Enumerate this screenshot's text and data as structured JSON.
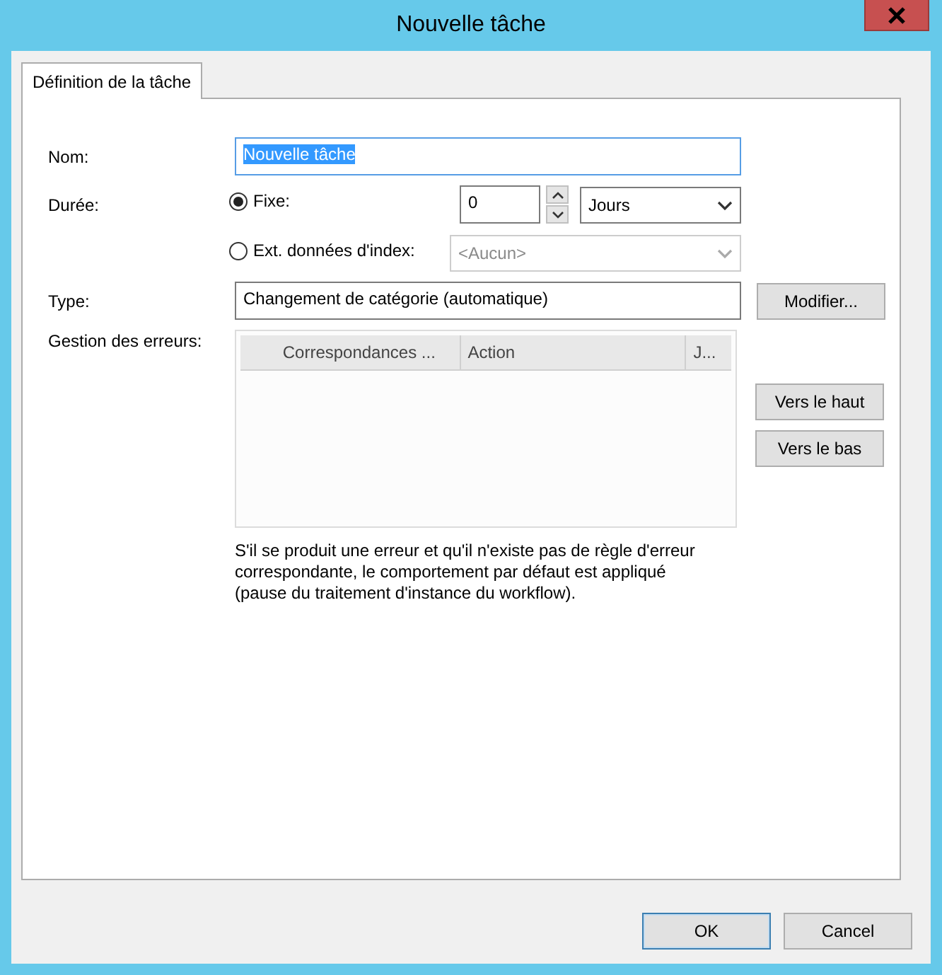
{
  "window": {
    "title": "Nouvelle tâche"
  },
  "tabs": [
    {
      "label": "Définition de la tâche",
      "selected": true
    }
  ],
  "name": {
    "label": "Nom:",
    "value": "Nouvelle tâche",
    "text_selected": true
  },
  "duration": {
    "label": "Durée:",
    "options": [
      {
        "kind": "fixed",
        "label": "Fixe:",
        "selected": true,
        "amount": "0",
        "unit": "Jours"
      },
      {
        "kind": "index",
        "label": "Ext. données d'index:",
        "selected": false,
        "source": "<Aucun>",
        "disabled": true
      }
    ]
  },
  "type": {
    "label": "Type:",
    "value": "Changement de catégorie (automatique)",
    "button": "Modifier..."
  },
  "errors": {
    "label": "Gestion des erreurs:",
    "columns": [
      {
        "label": "Correspondances ..."
      },
      {
        "label": "Action"
      },
      {
        "label": "J..."
      }
    ],
    "buttons": [
      "Vers le haut",
      "Vers le bas"
    ],
    "note": "S'il se produit une erreur et qu'il n'existe pas de règle d'erreur correspondante, le comportement par défaut est appliqué (pause du traitement d'instance du workflow)."
  },
  "buttons": [
    {
      "label": "OK",
      "default": true
    },
    {
      "label": "Cancel",
      "default": false
    }
  ]
}
